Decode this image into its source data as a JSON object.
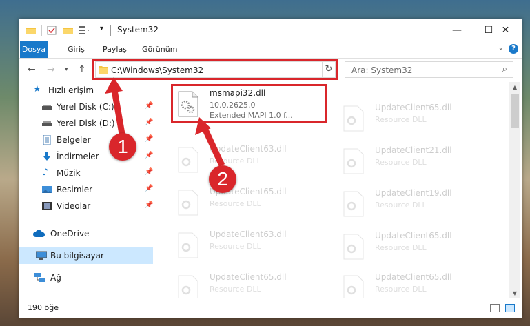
{
  "window": {
    "title": "System32",
    "controls": {
      "minimize": "—",
      "maximize": "☐",
      "close": "✕"
    }
  },
  "ribbon": {
    "tabs": [
      "Dosya",
      "Giriş",
      "Paylaş",
      "Görünüm"
    ],
    "help": "?"
  },
  "address": {
    "path": "C:\\Windows\\System32",
    "search_placeholder": "Ara: System32"
  },
  "nav": {
    "quick_access": "Hızlı erişim",
    "items": [
      {
        "label": "Yerel Disk (C:)",
        "icon": "drive-icon",
        "pinned": true
      },
      {
        "label": "Yerel Disk (D:)",
        "icon": "drive-icon",
        "pinned": true
      },
      {
        "label": "Belgeler",
        "icon": "documents-icon",
        "pinned": true
      },
      {
        "label": "İndirmeler",
        "icon": "downloads-icon",
        "pinned": true
      },
      {
        "label": "Müzik",
        "icon": "music-icon",
        "pinned": true
      },
      {
        "label": "Resimler",
        "icon": "pictures-icon",
        "pinned": true
      },
      {
        "label": "Videolar",
        "icon": "videos-icon",
        "pinned": true
      }
    ],
    "onedrive": "OneDrive",
    "this_pc": "Bu bilgisayar",
    "network": "Ağ"
  },
  "files": {
    "selected": {
      "name": "msmapi32.dll",
      "version": "10.0.2625.0",
      "description": "Extended MAPI 1.0 f..."
    },
    "left_column": [
      {
        "name": "UpdateClient63.dll",
        "type": "Resource DLL"
      },
      {
        "name": "UpdateClient65.dll",
        "type": "Resource DLL"
      },
      {
        "name": "UpdateClient63.dll",
        "type": "Resource DLL"
      },
      {
        "name": "UpdateClient65.dll",
        "type": "Resource DLL"
      }
    ],
    "right_column": [
      {
        "name": "UpdateClient65.dll",
        "type": "Resource DLL"
      },
      {
        "name": "UpdateClient21.dll",
        "type": "Resource DLL"
      },
      {
        "name": "UpdateClient19.dll",
        "type": "Resource DLL"
      },
      {
        "name": "UpdateClient65.dll",
        "type": "Resource DLL"
      },
      {
        "name": "UpdateClient65.dll",
        "type": "Resource DLL"
      }
    ]
  },
  "status": {
    "count": "190 öğe"
  },
  "callouts": [
    "1",
    "2"
  ],
  "colors": {
    "accent": "#1979ca",
    "highlight": "#d9262b",
    "selection": "#cce8ff"
  }
}
